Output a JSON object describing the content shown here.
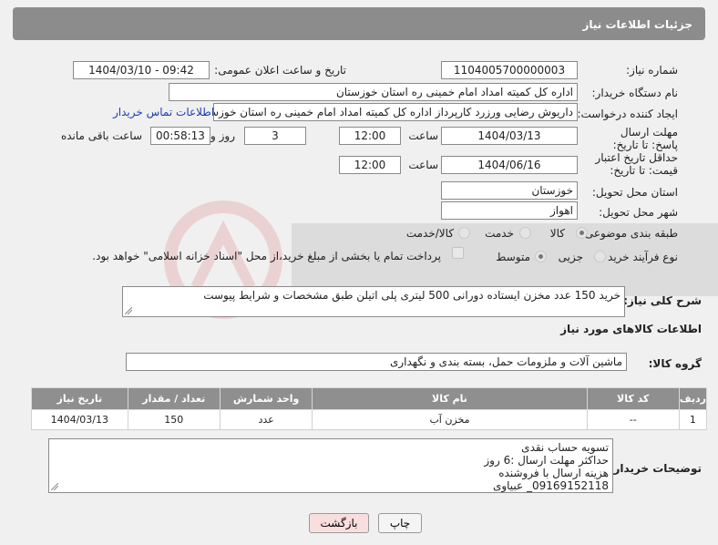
{
  "page_title": "جزئیات اطلاعات نیاز",
  "labels": {
    "need_number": "شماره نیاز:",
    "announce_datetime": "تاریخ و ساعت اعلان عمومی:",
    "buyer_org": "نام دستگاه خریدار:",
    "requester": "ایجاد کننده درخواست:",
    "reply_deadline": "مهلت ارسال پاسخ: تا تاریخ:",
    "price_validity": "حداقل تاریخ اعتبار قیمت: تا تاریخ:",
    "time": "ساعت",
    "days_and": "روز و",
    "time_remaining": "ساعت باقی مانده",
    "delivery_province": "استان محل تحویل:",
    "delivery_city": "شهر محل تحویل:",
    "category": "طبقه بندی موضوعی:",
    "process_type": "نوع فرآیند خرید :",
    "general_description": "شرح کلی نیاز:",
    "goods_info": "اطلاعات کالاهای مورد نیاز",
    "goods_group": "گروه کالا:",
    "buyer_notes": "توضیحات خریدار:"
  },
  "fields": {
    "need_number": "1104005700000003",
    "announce_datetime": "1404/03/10 - 09:42",
    "buyer_org": "اداره کل کمیته امداد امام خمینی  ره  استان خوزستان",
    "requester": "داریوش رضایی ورزرد کارپرداز اداره کل کمیته امداد امام خمینی  ره  استان خوزستان",
    "contact_link": "اطلاعات تماس خریدار",
    "reply_date": "1404/03/13",
    "reply_time": "12:00",
    "reply_days": "3",
    "reply_remaining": "00:58:13",
    "price_date": "1404/06/16",
    "price_time": "12:00",
    "province": "خوزستان",
    "city": "اهواز",
    "goods_group": "ماشین آلات و ملزومات حمل، بسته بندی و نگهداری",
    "description": "خرید 150 عدد مخزن ایستاده دورانی 500 لیتری پلی اتیلن طبق مشخصات و شرایط پیوست"
  },
  "category_options": [
    "کالا",
    "خدمت",
    "کالا/خدمت"
  ],
  "category_selected": "کالا",
  "process_options": [
    "جزیی",
    "متوسط"
  ],
  "process_selected": "متوسط",
  "payment_note": "پرداخت تمام یا بخشی از مبلغ خرید،از محل \"اسناد خزانه اسلامی\" خواهد بود.",
  "table": {
    "headers": [
      "ردیف",
      "کد کالا",
      "نام کالا",
      "واحد شمارش",
      "تعداد / مقدار",
      "تاریخ نیاز"
    ],
    "rows": [
      [
        "1",
        "--",
        "مخزن آب",
        "عدد",
        "150",
        "1404/03/13"
      ]
    ]
  },
  "notes_lines": [
    "تسویه حساب نقدی",
    "حداکثر مهلت ارسال :6 روز",
    "هزینه ارسال با فروشنده",
    "09169152118_ عبیاوی"
  ],
  "buttons": {
    "print": "چاپ",
    "back": "بازگشت"
  },
  "colors": {
    "header_bg": "#8c8c8c",
    "link": "#1a3fb3",
    "back_button_bg": "#f9dede"
  }
}
